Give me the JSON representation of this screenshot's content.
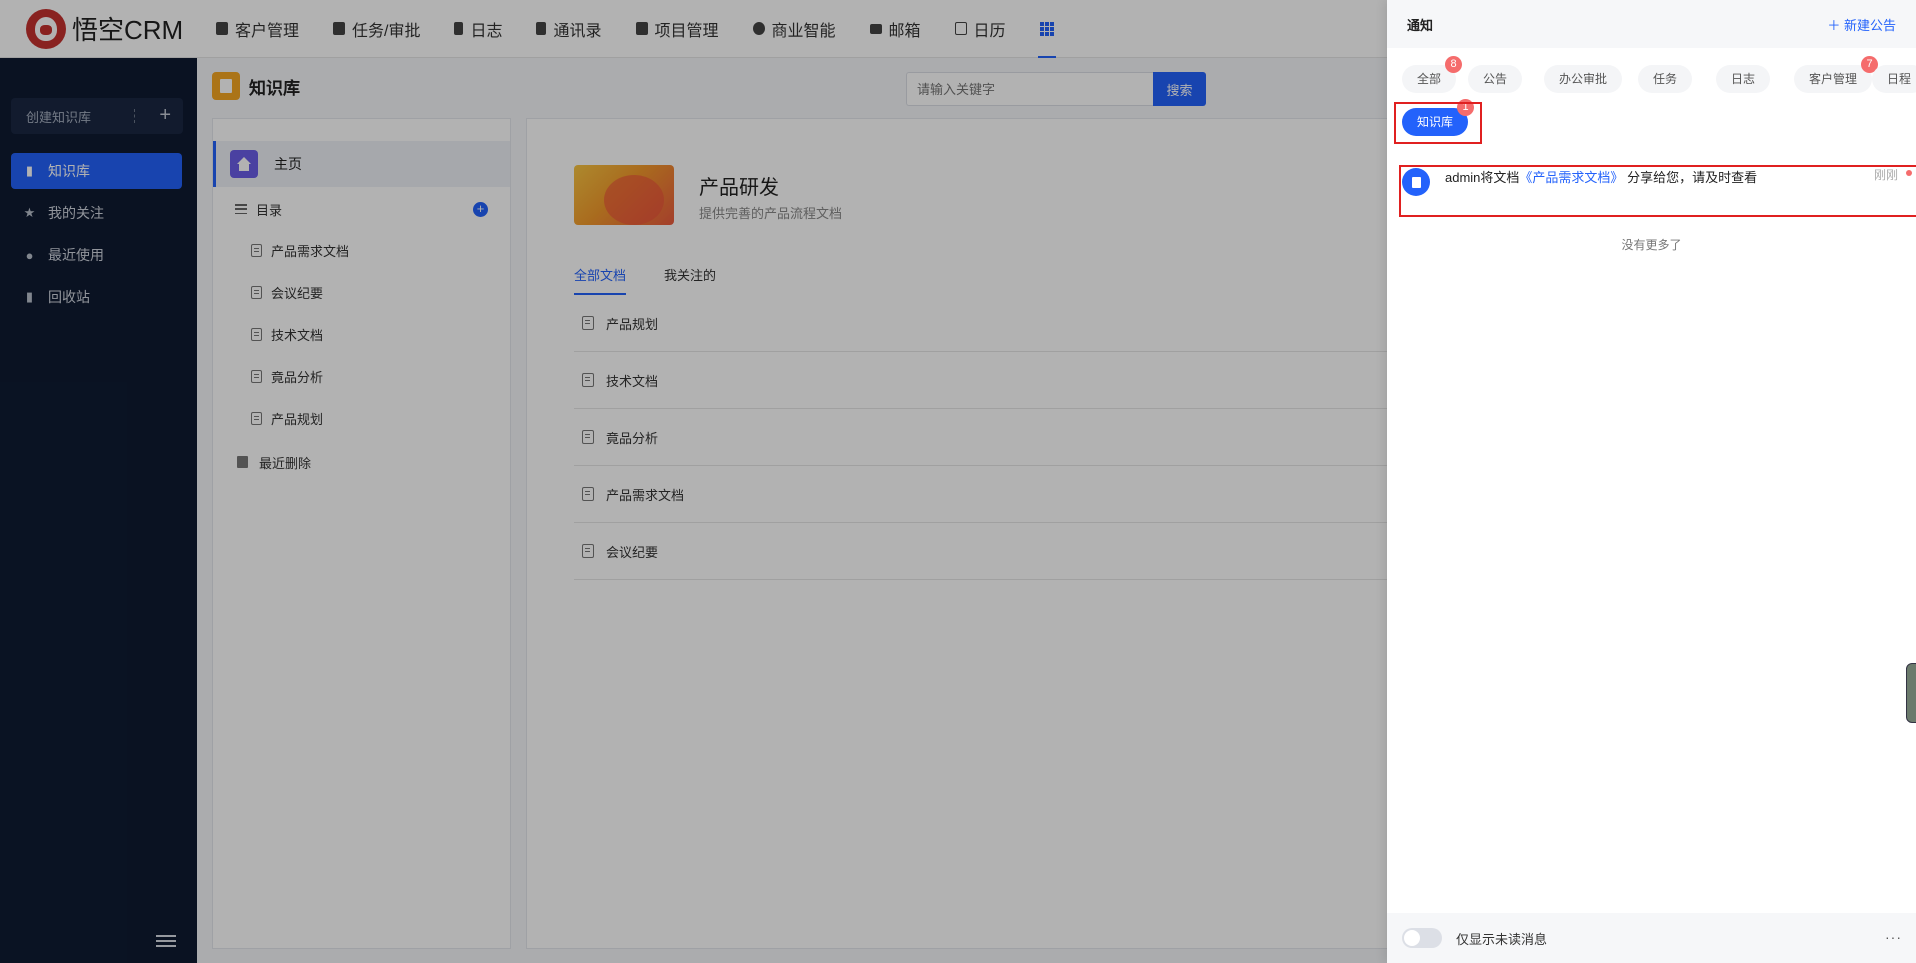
{
  "topnav": {
    "logo_text": "悟空CRM",
    "items": [
      {
        "label": "客户管理",
        "icon": "building-icon"
      },
      {
        "label": "任务/审批",
        "icon": "briefcase-icon"
      },
      {
        "label": "日志",
        "icon": "journal-icon"
      },
      {
        "label": "通讯录",
        "icon": "contact-book-icon"
      },
      {
        "label": "项目管理",
        "icon": "project-list-icon"
      },
      {
        "label": "商业智能",
        "icon": "cube-icon"
      },
      {
        "label": "邮箱",
        "icon": "mail-icon"
      },
      {
        "label": "日历",
        "icon": "calendar-icon"
      }
    ],
    "apps_icon": "grid-apps-icon"
  },
  "sidebar": {
    "create_label": "创建知识库",
    "items": [
      {
        "label": "知识库",
        "icon": "book-icon",
        "active": true
      },
      {
        "label": "我的关注",
        "icon": "star-icon",
        "active": false
      },
      {
        "label": "最近使用",
        "icon": "clock-icon",
        "active": false
      },
      {
        "label": "回收站",
        "icon": "trash-icon",
        "active": false
      }
    ]
  },
  "header": {
    "title": "知识库",
    "search_placeholder": "请输入关键字",
    "search_button": "搜索"
  },
  "tree": {
    "home_label": "主页",
    "catalog_label": "目录",
    "docs": [
      "产品需求文档",
      "会议纪要",
      "技术文档",
      "竟品分析",
      "产品规划"
    ],
    "recent_deleted_label": "最近删除"
  },
  "main": {
    "kb_name": "产品研发",
    "kb_desc": "提供完善的产品流程文档",
    "tabs": [
      "全部文档",
      "我关注的"
    ],
    "docs": [
      "产品规划",
      "技术文档",
      "竟品分析",
      "产品需求文档",
      "会议纪要"
    ]
  },
  "drawer": {
    "title": "通知",
    "new_notice": "新建公告",
    "chips": [
      {
        "label": "全部",
        "badge": "8"
      },
      {
        "label": "公告",
        "badge": ""
      },
      {
        "label": "办公审批",
        "badge": ""
      },
      {
        "label": "任务",
        "badge": ""
      },
      {
        "label": "日志",
        "badge": ""
      },
      {
        "label": "客户管理",
        "badge": "7"
      },
      {
        "label": "日程",
        "badge": ""
      },
      {
        "label": "知识库",
        "badge": "1"
      }
    ],
    "message": {
      "prefix": "admin将文档",
      "link": "《产品需求文档》",
      "suffix": "分享给您，请及时查看",
      "time": "刚刚"
    },
    "no_more": "没有更多了",
    "footer_label": "仅显示未读消息",
    "more": "···"
  },
  "colors": {
    "accent": "#2362fb",
    "sidebar_bg": "#0f1b32",
    "badge": "#f56c6c",
    "highlight_box": "#e02020"
  }
}
